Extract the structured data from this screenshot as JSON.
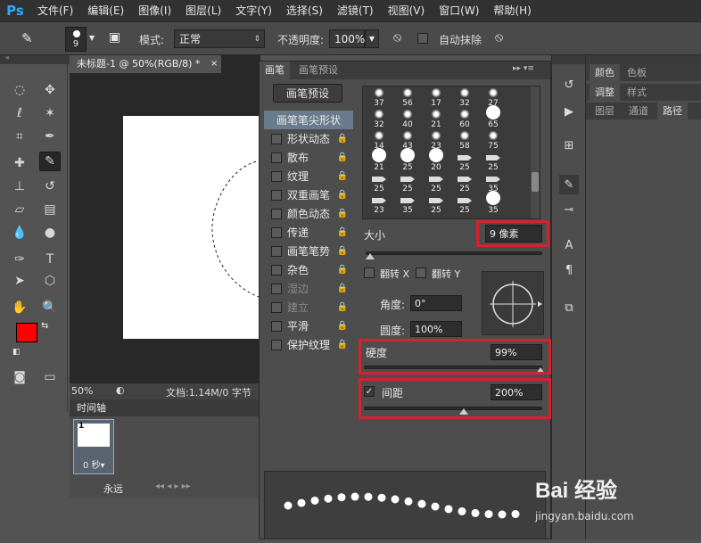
{
  "menubar": {
    "logo": "Ps",
    "items": [
      "文件(F)",
      "编辑(E)",
      "图像(I)",
      "图层(L)",
      "文字(Y)",
      "选择(S)",
      "滤镜(T)",
      "视图(V)",
      "窗口(W)",
      "帮助(H)"
    ]
  },
  "options": {
    "brush_size": "9",
    "mode_label": "模式:",
    "mode_value": "正常",
    "opacity_label": "不透明度:",
    "opacity_value": "100%",
    "auto_erase_label": "自动抹除"
  },
  "document": {
    "tab_title": "未标题-1 @ 50%(RGB/8) *",
    "zoom": "50%",
    "doc_info": "文档:1.14M/0 字节"
  },
  "timeline": {
    "title": "时间轴",
    "frame_number": "1",
    "frame_delay": "0 秒▾",
    "loop": "永远"
  },
  "brush_panel": {
    "tab_brush": "画笔",
    "tab_presets": "画笔预设",
    "presets_button": "画笔预设",
    "list": [
      {
        "label": "画笔笔尖形状",
        "type": "header"
      },
      {
        "label": "形状动态",
        "checked": false,
        "disabled": false
      },
      {
        "label": "散布",
        "checked": false,
        "disabled": false
      },
      {
        "label": "纹理",
        "checked": false,
        "disabled": false
      },
      {
        "label": "双重画笔",
        "checked": false,
        "disabled": false
      },
      {
        "label": "颜色动态",
        "checked": false,
        "disabled": false
      },
      {
        "label": "传递",
        "checked": false,
        "disabled": false
      },
      {
        "label": "画笔笔势",
        "checked": false,
        "disabled": false
      },
      {
        "label": "杂色",
        "checked": false,
        "disabled": false
      },
      {
        "label": "湿边",
        "checked": false,
        "disabled": true
      },
      {
        "label": "建立",
        "checked": false,
        "disabled": true
      },
      {
        "label": "平滑",
        "checked": false,
        "disabled": false
      },
      {
        "label": "保护纹理",
        "checked": false,
        "disabled": false
      }
    ],
    "tips": [
      "37",
      "56",
      "17",
      "32",
      "27",
      "32",
      "40",
      "21",
      "60",
      "65",
      "14",
      "43",
      "23",
      "58",
      "75",
      "21",
      "25",
      "20",
      "25",
      "25",
      "25",
      "25",
      "25",
      "25",
      "35",
      "23",
      "35",
      "25",
      "25",
      "35"
    ],
    "size_label": "大小",
    "size_value": "9 像素",
    "flip_x": "翻转 X",
    "flip_y": "翻转 Y",
    "angle_label": "角度:",
    "angle_value": "0°",
    "roundness_label": "圆度:",
    "roundness_value": "100%",
    "hardness_label": "硬度",
    "hardness_value": "99%",
    "hardness_level": 0.99,
    "spacing_label": "间距",
    "spacing_value": "200%",
    "spacing_checked": "✓",
    "spacing_level": 0.2
  },
  "right_panels": {
    "row1": [
      "颜色",
      "色板"
    ],
    "row2": [
      "调整",
      "样式"
    ],
    "row3": [
      "图层",
      "通道",
      "路径"
    ]
  },
  "watermark": {
    "brand": "Bai 经验",
    "url": "jingyan.baidu.com"
  },
  "colors": {
    "foreground": "#ff0000",
    "background": "#ffffff",
    "highlight": "#d4232d"
  }
}
